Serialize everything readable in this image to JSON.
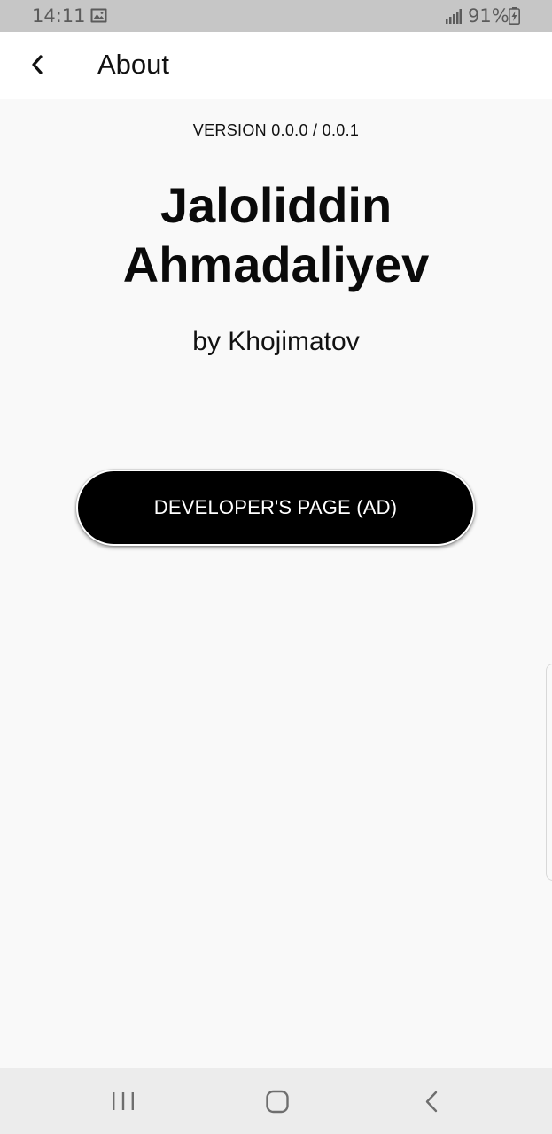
{
  "status_bar": {
    "time": "14:11",
    "battery": "91%",
    "icons": [
      "image-notification-icon",
      "signal-icon",
      "battery-charging-icon"
    ]
  },
  "app_bar": {
    "title": "About",
    "back_icon": "chevron-left-icon"
  },
  "main": {
    "version": "VERSION 0.0.0 / 0.0.1",
    "app_name": "Jaloliddin Ahmadaliyev",
    "author": "by Khojimatov",
    "developer_button_label": "DEVELOPER'S PAGE (AD)"
  },
  "nav_bar": {
    "items": [
      "recents-icon",
      "home-icon",
      "back-icon"
    ]
  },
  "colors": {
    "status_bar": "#c6c6c6",
    "app_bar": "#ffffff",
    "background": "#f9f9f9",
    "button": "#000000",
    "button_text": "#ffffff",
    "nav_bar": "#ececec"
  }
}
